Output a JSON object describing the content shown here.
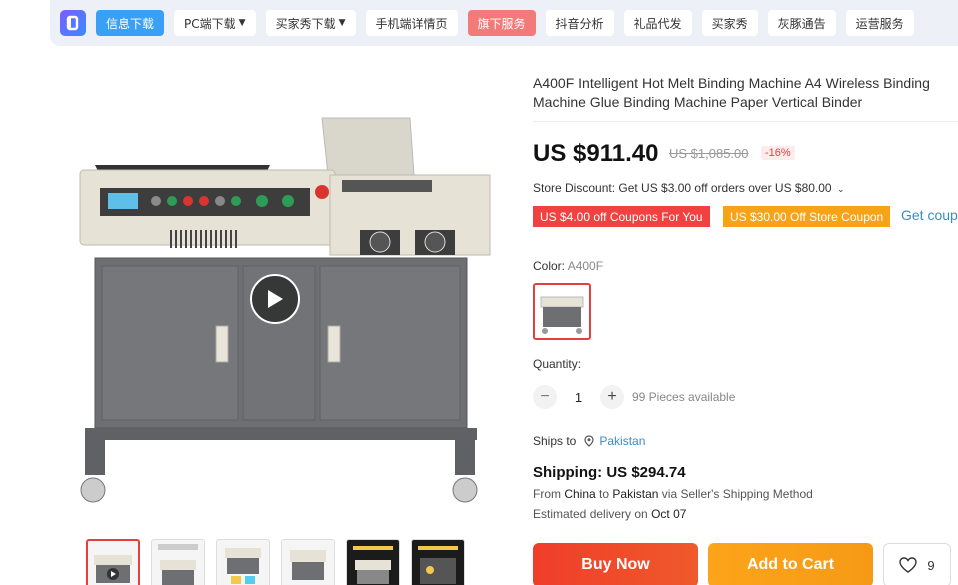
{
  "toolbar": {
    "items": [
      {
        "label": "信息下载",
        "style": "blue"
      },
      {
        "label": "PC端下载",
        "caret": true
      },
      {
        "label": "买家秀下载",
        "caret": true
      },
      {
        "label": "手机端详情页"
      },
      {
        "label": "旗下服务",
        "style": "red"
      },
      {
        "label": "抖音分析"
      },
      {
        "label": "礼品代发"
      },
      {
        "label": "买家秀"
      },
      {
        "label": "灰豚通告"
      },
      {
        "label": "运营服务"
      }
    ]
  },
  "product": {
    "title": "A400F Intelligent Hot Melt Binding Machine A4 Wireless Binding Machine Glue Binding Machine Paper Vertical Binder",
    "price": "US $911.40",
    "original_price": "US $1,085.00",
    "discount": "-16%",
    "store_discount": "Store Discount: Get US $3.00 off orders over US $80.00",
    "coupons": [
      "US $4.00 off Coupons For You",
      "US $30.00 Off Store Coupon"
    ],
    "get_coupons": "Get coupons",
    "color_label": "Color:",
    "color_value": "A400F",
    "quantity_label": "Quantity:",
    "quantity": "1",
    "available": "99 Pieces available",
    "ships_to_label": "Ships to",
    "ships_to_country": "Pakistan",
    "shipping_fee": "Shipping: US $294.74",
    "ship_from_prefix": "From",
    "ship_from_origin": "China",
    "ship_from_to": "to",
    "ship_from_dest": "Pakistan",
    "ship_from_method": "via Seller's Shipping Method",
    "delivery_prefix": "Estimated delivery on",
    "delivery_date": "Oct 07",
    "buy_now": "Buy Now",
    "add_to_cart": "Add to Cart",
    "wishlist_count": "9"
  },
  "icons": {
    "play": "play-icon",
    "location": "location-pin-icon",
    "heart": "heart-icon",
    "chevron": "chevron-down-icon"
  },
  "colors": {
    "accent_red": "#e23f3f",
    "buy_now": "#f03d2a",
    "add_to_cart": "#fda41a",
    "link_blue": "#3a8bc8"
  }
}
